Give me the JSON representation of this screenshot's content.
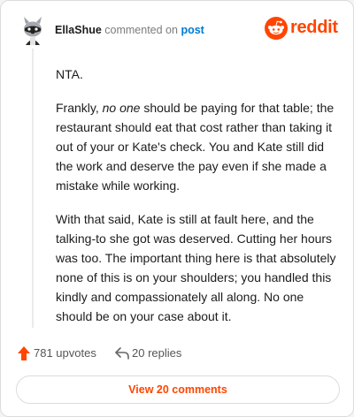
{
  "header": {
    "username": "EllaShue",
    "action_text": "commented on",
    "post_link": "post",
    "brand": "reddit",
    "brand_color": "#ff4500"
  },
  "comment": {
    "p1": "NTA.",
    "p2_before": "Frankly, ",
    "p2_emphasis": "no one",
    "p2_after": " should be paying for that table; the restaurant should eat that cost rather than taking it out of your or Kate's check. You and Kate still did the work and deserve the pay even if she made a mistake while working.",
    "p3": "With that said, Kate is still at fault here, and the talking-to she got was deserved. Cutting her hours was too. The important thing here is that absolutely none of this is on your shoulders; you handled this kindly and compassionately all along. No one should be on your case about it."
  },
  "actions": {
    "upvotes": "781 upvotes",
    "replies": "20 replies",
    "upvote_icon": "upvote-arrow-icon",
    "reply_icon": "reply-arrow-icon"
  },
  "footer": {
    "view_comments": "View 20 comments"
  }
}
